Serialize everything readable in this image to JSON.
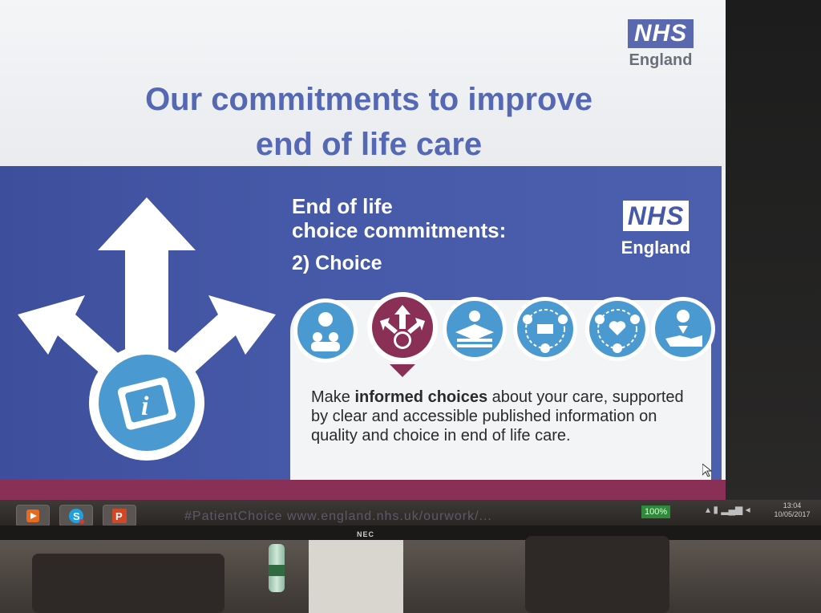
{
  "slide": {
    "top_logo": {
      "nhs": "NHS",
      "england": "England"
    },
    "title_line1": "Our commitments to improve",
    "title_line2": "end of life care",
    "heading_line1": "End of life",
    "heading_line2": "choice commitments:",
    "subheading": "2) Choice",
    "band_logo": {
      "nhs": "NHS",
      "england": "England"
    },
    "description_pre": "Make ",
    "description_bold": "informed choices",
    "description_post": " about your care, supported by clear and accessible published information on quality and choice in end of life care.",
    "commitment_icons": [
      {
        "name": "people-care-icon",
        "selected": false
      },
      {
        "name": "choice-arrows-icon",
        "selected": true
      },
      {
        "name": "documents-stack-icon",
        "selected": false
      },
      {
        "name": "connected-people-icon",
        "selected": false
      },
      {
        "name": "heart-network-icon",
        "selected": false
      },
      {
        "name": "hand-support-icon",
        "selected": false
      }
    ],
    "colors": {
      "band_blue": "#4659a8",
      "icon_blue": "#4a9ad1",
      "selected_maroon": "#8a2f55",
      "title_blue": "#5568b3"
    }
  },
  "taskbar": {
    "url_text": "#PatientChoice   www.england.nhs.uk/ourwork/...",
    "battery": "100%",
    "time": "13:04",
    "date": "10/05/2017",
    "apps": [
      "media-player-icon",
      "skype-icon",
      "powerpoint-icon"
    ]
  },
  "monitor": {
    "brand": "NEC"
  }
}
